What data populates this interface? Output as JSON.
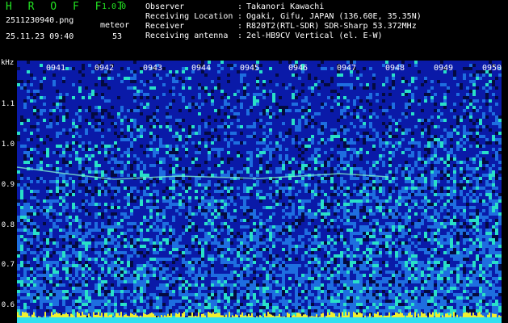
{
  "header": {
    "app_title": "H R O F F T",
    "app_version": "1.0.0",
    "filename": "2511230940.png",
    "datetime": "25.11.23 09:40",
    "meteor_label": "meteor",
    "meteor_count": "53"
  },
  "info": [
    {
      "key": "Observer",
      "value": "Takanori Kawachi"
    },
    {
      "key": "Receiving Location",
      "value": "Ogaki, Gifu, JAPAN (136.60E, 35.35N)"
    },
    {
      "key": "Receiver",
      "value": "R820T2(RTL-SDR) SDR-Sharp 53.372MHz"
    },
    {
      "key": "Receiving antenna",
      "value": "2el-HB9CV Vertical (el. E-W)"
    }
  ],
  "axes": {
    "y_unit": "kHz",
    "y_ticks": [
      "1.1",
      "1.0",
      "0.9",
      "0.8",
      "0.7",
      "0.6"
    ],
    "x_ticks": [
      "0941",
      "0942",
      "0943",
      "0944",
      "0945",
      "0946",
      "0947",
      "0948",
      "0949",
      "0950"
    ]
  },
  "colors": {
    "background": "#000000",
    "title_green": "#22e222",
    "spectrum_low": "#0a1aa8",
    "spectrum_mid": "#1e6ee0",
    "spectrum_high": "#28e0c8",
    "spectrum_peak": "#f0f030"
  }
}
